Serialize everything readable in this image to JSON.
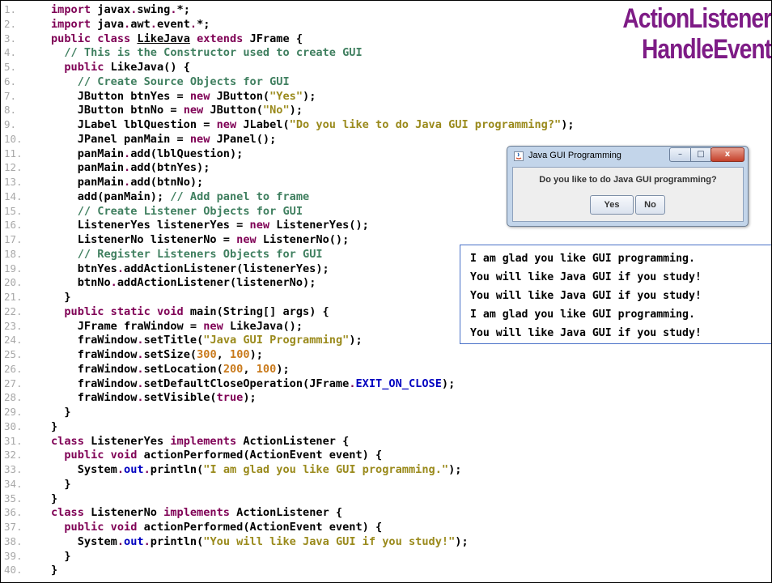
{
  "title": "ActionListener HandleEvent",
  "code_lines": [
    {
      "n": "1.",
      "t": [
        [
          "kw",
          "import "
        ],
        [
          "tx",
          "javax"
        ],
        [
          "kw",
          "."
        ],
        [
          "tx",
          "swing"
        ],
        [
          "kw",
          "."
        ],
        [
          "tx",
          "*;"
        ]
      ]
    },
    {
      "n": "2.",
      "t": [
        [
          "kw",
          "import "
        ],
        [
          "tx",
          "java"
        ],
        [
          "kw",
          "."
        ],
        [
          "tx",
          "awt"
        ],
        [
          "kw",
          "."
        ],
        [
          "tx",
          "event"
        ],
        [
          "kw",
          "."
        ],
        [
          "tx",
          "*;"
        ]
      ]
    },
    {
      "n": "3.",
      "t": [
        [
          "kw",
          "public class "
        ],
        [
          "cls",
          "LikeJava"
        ],
        [
          "kw",
          " extends "
        ],
        [
          "tx",
          "JFrame {"
        ]
      ]
    },
    {
      "n": "4.",
      "t": [
        [
          "tx",
          "  "
        ],
        [
          "cm",
          "// This is the Constructor used to create GUI"
        ]
      ]
    },
    {
      "n": "5.",
      "t": [
        [
          "tx",
          "  "
        ],
        [
          "kw",
          "public "
        ],
        [
          "tx",
          "LikeJava() {"
        ]
      ]
    },
    {
      "n": "6.",
      "t": [
        [
          "tx",
          "    "
        ],
        [
          "cm",
          "// Create Source Objects for GUI"
        ]
      ]
    },
    {
      "n": "7.",
      "t": [
        [
          "tx",
          "    JButton btnYes = "
        ],
        [
          "kw",
          "new "
        ],
        [
          "tx",
          "JButton("
        ],
        [
          "str",
          "\"Yes\""
        ],
        [
          "tx",
          ");"
        ]
      ]
    },
    {
      "n": "8.",
      "t": [
        [
          "tx",
          "    JButton btnNo = "
        ],
        [
          "kw",
          "new "
        ],
        [
          "tx",
          "JButton("
        ],
        [
          "str",
          "\"No\""
        ],
        [
          "tx",
          ");"
        ]
      ]
    },
    {
      "n": "9.",
      "t": [
        [
          "tx",
          "    JLabel lblQuestion = "
        ],
        [
          "kw",
          "new "
        ],
        [
          "tx",
          "JLabel("
        ],
        [
          "str",
          "\"Do you like to do Java GUI programming?\""
        ],
        [
          "tx",
          ");"
        ]
      ]
    },
    {
      "n": "10.",
      "t": [
        [
          "tx",
          "    JPanel panMain = "
        ],
        [
          "kw",
          "new "
        ],
        [
          "tx",
          "JPanel();"
        ]
      ]
    },
    {
      "n": "11.",
      "t": [
        [
          "tx",
          "    panMain"
        ],
        [
          "kw",
          "."
        ],
        [
          "tx",
          "add(lblQuestion);"
        ]
      ]
    },
    {
      "n": "12.",
      "t": [
        [
          "tx",
          "    panMain"
        ],
        [
          "kw",
          "."
        ],
        [
          "tx",
          "add(btnYes);"
        ]
      ]
    },
    {
      "n": "13.",
      "t": [
        [
          "tx",
          "    panMain"
        ],
        [
          "kw",
          "."
        ],
        [
          "tx",
          "add(btnNo);"
        ]
      ]
    },
    {
      "n": "14.",
      "t": [
        [
          "tx",
          "    add(panMain); "
        ],
        [
          "cm",
          "// Add panel to frame"
        ]
      ]
    },
    {
      "n": "15.",
      "t": [
        [
          "tx",
          "    "
        ],
        [
          "cm",
          "// Create Listener Objects for GUI"
        ]
      ]
    },
    {
      "n": "16.",
      "t": [
        [
          "tx",
          "    ListenerYes listenerYes = "
        ],
        [
          "kw",
          "new "
        ],
        [
          "tx",
          "ListenerYes();"
        ]
      ]
    },
    {
      "n": "17.",
      "t": [
        [
          "tx",
          "    ListenerNo listenerNo = "
        ],
        [
          "kw",
          "new "
        ],
        [
          "tx",
          "ListenerNo();"
        ]
      ]
    },
    {
      "n": "18.",
      "t": [
        [
          "tx",
          "    "
        ],
        [
          "cm",
          "// Register Listeners Objects for GUI"
        ]
      ]
    },
    {
      "n": "19.",
      "t": [
        [
          "tx",
          "    btnYes"
        ],
        [
          "kw",
          "."
        ],
        [
          "tx",
          "addActionListener(listenerYes);"
        ]
      ]
    },
    {
      "n": "20.",
      "t": [
        [
          "tx",
          "    btnNo"
        ],
        [
          "kw",
          "."
        ],
        [
          "tx",
          "addActionListener(listenerNo);"
        ]
      ]
    },
    {
      "n": "21.",
      "t": [
        [
          "tx",
          "  }"
        ]
      ]
    },
    {
      "n": "22.",
      "t": [
        [
          "tx",
          "  "
        ],
        [
          "kw",
          "public static void "
        ],
        [
          "tx",
          "main(String[] args) {"
        ]
      ]
    },
    {
      "n": "23.",
      "t": [
        [
          "tx",
          "    JFrame fraWindow = "
        ],
        [
          "kw",
          "new "
        ],
        [
          "tx",
          "LikeJava();"
        ]
      ]
    },
    {
      "n": "24.",
      "t": [
        [
          "tx",
          "    fraWindow"
        ],
        [
          "kw",
          "."
        ],
        [
          "tx",
          "setTitle("
        ],
        [
          "str",
          "\"Java GUI Programming\""
        ],
        [
          "tx",
          ");"
        ]
      ]
    },
    {
      "n": "25.",
      "t": [
        [
          "tx",
          "    fraWindow"
        ],
        [
          "kw",
          "."
        ],
        [
          "tx",
          "setSize("
        ],
        [
          "num",
          "300"
        ],
        [
          "tx",
          ", "
        ],
        [
          "num",
          "100"
        ],
        [
          "tx",
          ");"
        ]
      ]
    },
    {
      "n": "26.",
      "t": [
        [
          "tx",
          "    fraWindow"
        ],
        [
          "kw",
          "."
        ],
        [
          "tx",
          "setLocation("
        ],
        [
          "num",
          "200"
        ],
        [
          "tx",
          ", "
        ],
        [
          "num",
          "100"
        ],
        [
          "tx",
          ");"
        ]
      ]
    },
    {
      "n": "27.",
      "t": [
        [
          "tx",
          "    fraWindow"
        ],
        [
          "kw",
          "."
        ],
        [
          "tx",
          "setDefaultCloseOperation(JFrame"
        ],
        [
          "kw",
          "."
        ],
        [
          "fld",
          "EXIT_ON_CLOSE"
        ],
        [
          "tx",
          ");"
        ]
      ]
    },
    {
      "n": "28.",
      "t": [
        [
          "tx",
          "    fraWindow"
        ],
        [
          "kw",
          "."
        ],
        [
          "tx",
          "setVisible("
        ],
        [
          "kw",
          "true"
        ],
        [
          "tx",
          ");"
        ]
      ]
    },
    {
      "n": "29.",
      "t": [
        [
          "tx",
          "  }"
        ]
      ]
    },
    {
      "n": "30.",
      "t": [
        [
          "tx",
          "}"
        ]
      ]
    },
    {
      "n": "31.",
      "t": [
        [
          "kw",
          "class "
        ],
        [
          "tx",
          "ListenerYes "
        ],
        [
          "kw",
          "implements "
        ],
        [
          "tx",
          "ActionListener {"
        ]
      ]
    },
    {
      "n": "32.",
      "t": [
        [
          "tx",
          "  "
        ],
        [
          "kw",
          "public void "
        ],
        [
          "tx",
          "actionPerformed(ActionEvent event) {"
        ]
      ]
    },
    {
      "n": "33.",
      "t": [
        [
          "tx",
          "    System"
        ],
        [
          "kw",
          "."
        ],
        [
          "fld",
          "out"
        ],
        [
          "kw",
          "."
        ],
        [
          "tx",
          "println("
        ],
        [
          "str",
          "\"I am glad you like GUI programming.\""
        ],
        [
          "tx",
          ");"
        ]
      ]
    },
    {
      "n": "34.",
      "t": [
        [
          "tx",
          "  }"
        ]
      ]
    },
    {
      "n": "35.",
      "t": [
        [
          "tx",
          "}"
        ]
      ]
    },
    {
      "n": "36.",
      "t": [
        [
          "kw",
          "class "
        ],
        [
          "tx",
          "ListenerNo "
        ],
        [
          "kw",
          "implements "
        ],
        [
          "tx",
          "ActionListener {"
        ]
      ]
    },
    {
      "n": "37.",
      "t": [
        [
          "tx",
          "  "
        ],
        [
          "kw",
          "public void "
        ],
        [
          "tx",
          "actionPerformed(ActionEvent event) {"
        ]
      ]
    },
    {
      "n": "38.",
      "t": [
        [
          "tx",
          "    System"
        ],
        [
          "kw",
          "."
        ],
        [
          "fld",
          "out"
        ],
        [
          "kw",
          "."
        ],
        [
          "tx",
          "println("
        ],
        [
          "str",
          "\"You will like Java GUI if you study!\""
        ],
        [
          "tx",
          ");"
        ]
      ]
    },
    {
      "n": "39.",
      "t": [
        [
          "tx",
          "  }"
        ]
      ]
    },
    {
      "n": "40.",
      "t": [
        [
          "tx",
          "}"
        ]
      ]
    }
  ],
  "gui_window": {
    "title": "Java GUI Programming",
    "question": "Do you like to do Java GUI programming?",
    "yes_label": "Yes",
    "no_label": "No",
    "minimize_glyph": "–",
    "maximize_glyph": "□",
    "close_glyph": "x",
    "app_icon": "java-icon"
  },
  "console_output": [
    "I am glad you like GUI programming.",
    "You will like Java GUI if you study!",
    "You will like Java GUI if you study!",
    "I am glad you like GUI programming.",
    "You will like Java GUI if you study!"
  ],
  "colors": {
    "keyword": "#7f0055",
    "string": "#9a8a1c",
    "comment": "#3f7f5f",
    "number": "#c97a1c",
    "field": "#0000c0",
    "title": "#7e1c86"
  }
}
